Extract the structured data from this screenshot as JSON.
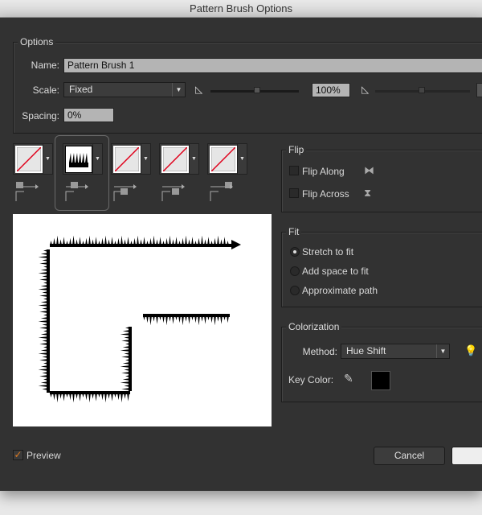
{
  "window": {
    "title": "Pattern Brush Options"
  },
  "options": {
    "legend": "Options",
    "name_label": "Name:",
    "name_value": "Pattern Brush 1",
    "scale_label": "Scale:",
    "scale_value": "Fixed",
    "scale_percent": "100%",
    "scale_slider_percent": 50,
    "spacing_label": "Spacing:",
    "spacing_value": "0%"
  },
  "tiles": [
    {
      "name": "side-tile"
    },
    {
      "name": "outer-corner-tile",
      "selected": true
    },
    {
      "name": "inner-corner-tile"
    },
    {
      "name": "start-tile"
    },
    {
      "name": "end-tile"
    }
  ],
  "flip": {
    "legend": "Flip",
    "along": "Flip Along",
    "across": "Flip Across",
    "along_checked": false,
    "across_checked": false
  },
  "fit": {
    "legend": "Fit",
    "options": [
      "Stretch to fit",
      "Add space to fit",
      "Approximate path"
    ],
    "selected": "Stretch to fit"
  },
  "colorization": {
    "legend": "Colorization",
    "method_label": "Method:",
    "method_value": "Hue Shift",
    "key_color_label": "Key Color:",
    "key_color": "#000000"
  },
  "footer": {
    "preview_label": "Preview",
    "preview_checked": true,
    "cancel": "Cancel"
  },
  "colors": {
    "checkbox_accent": "#e07b20",
    "swatch_line": "#e0001b"
  }
}
